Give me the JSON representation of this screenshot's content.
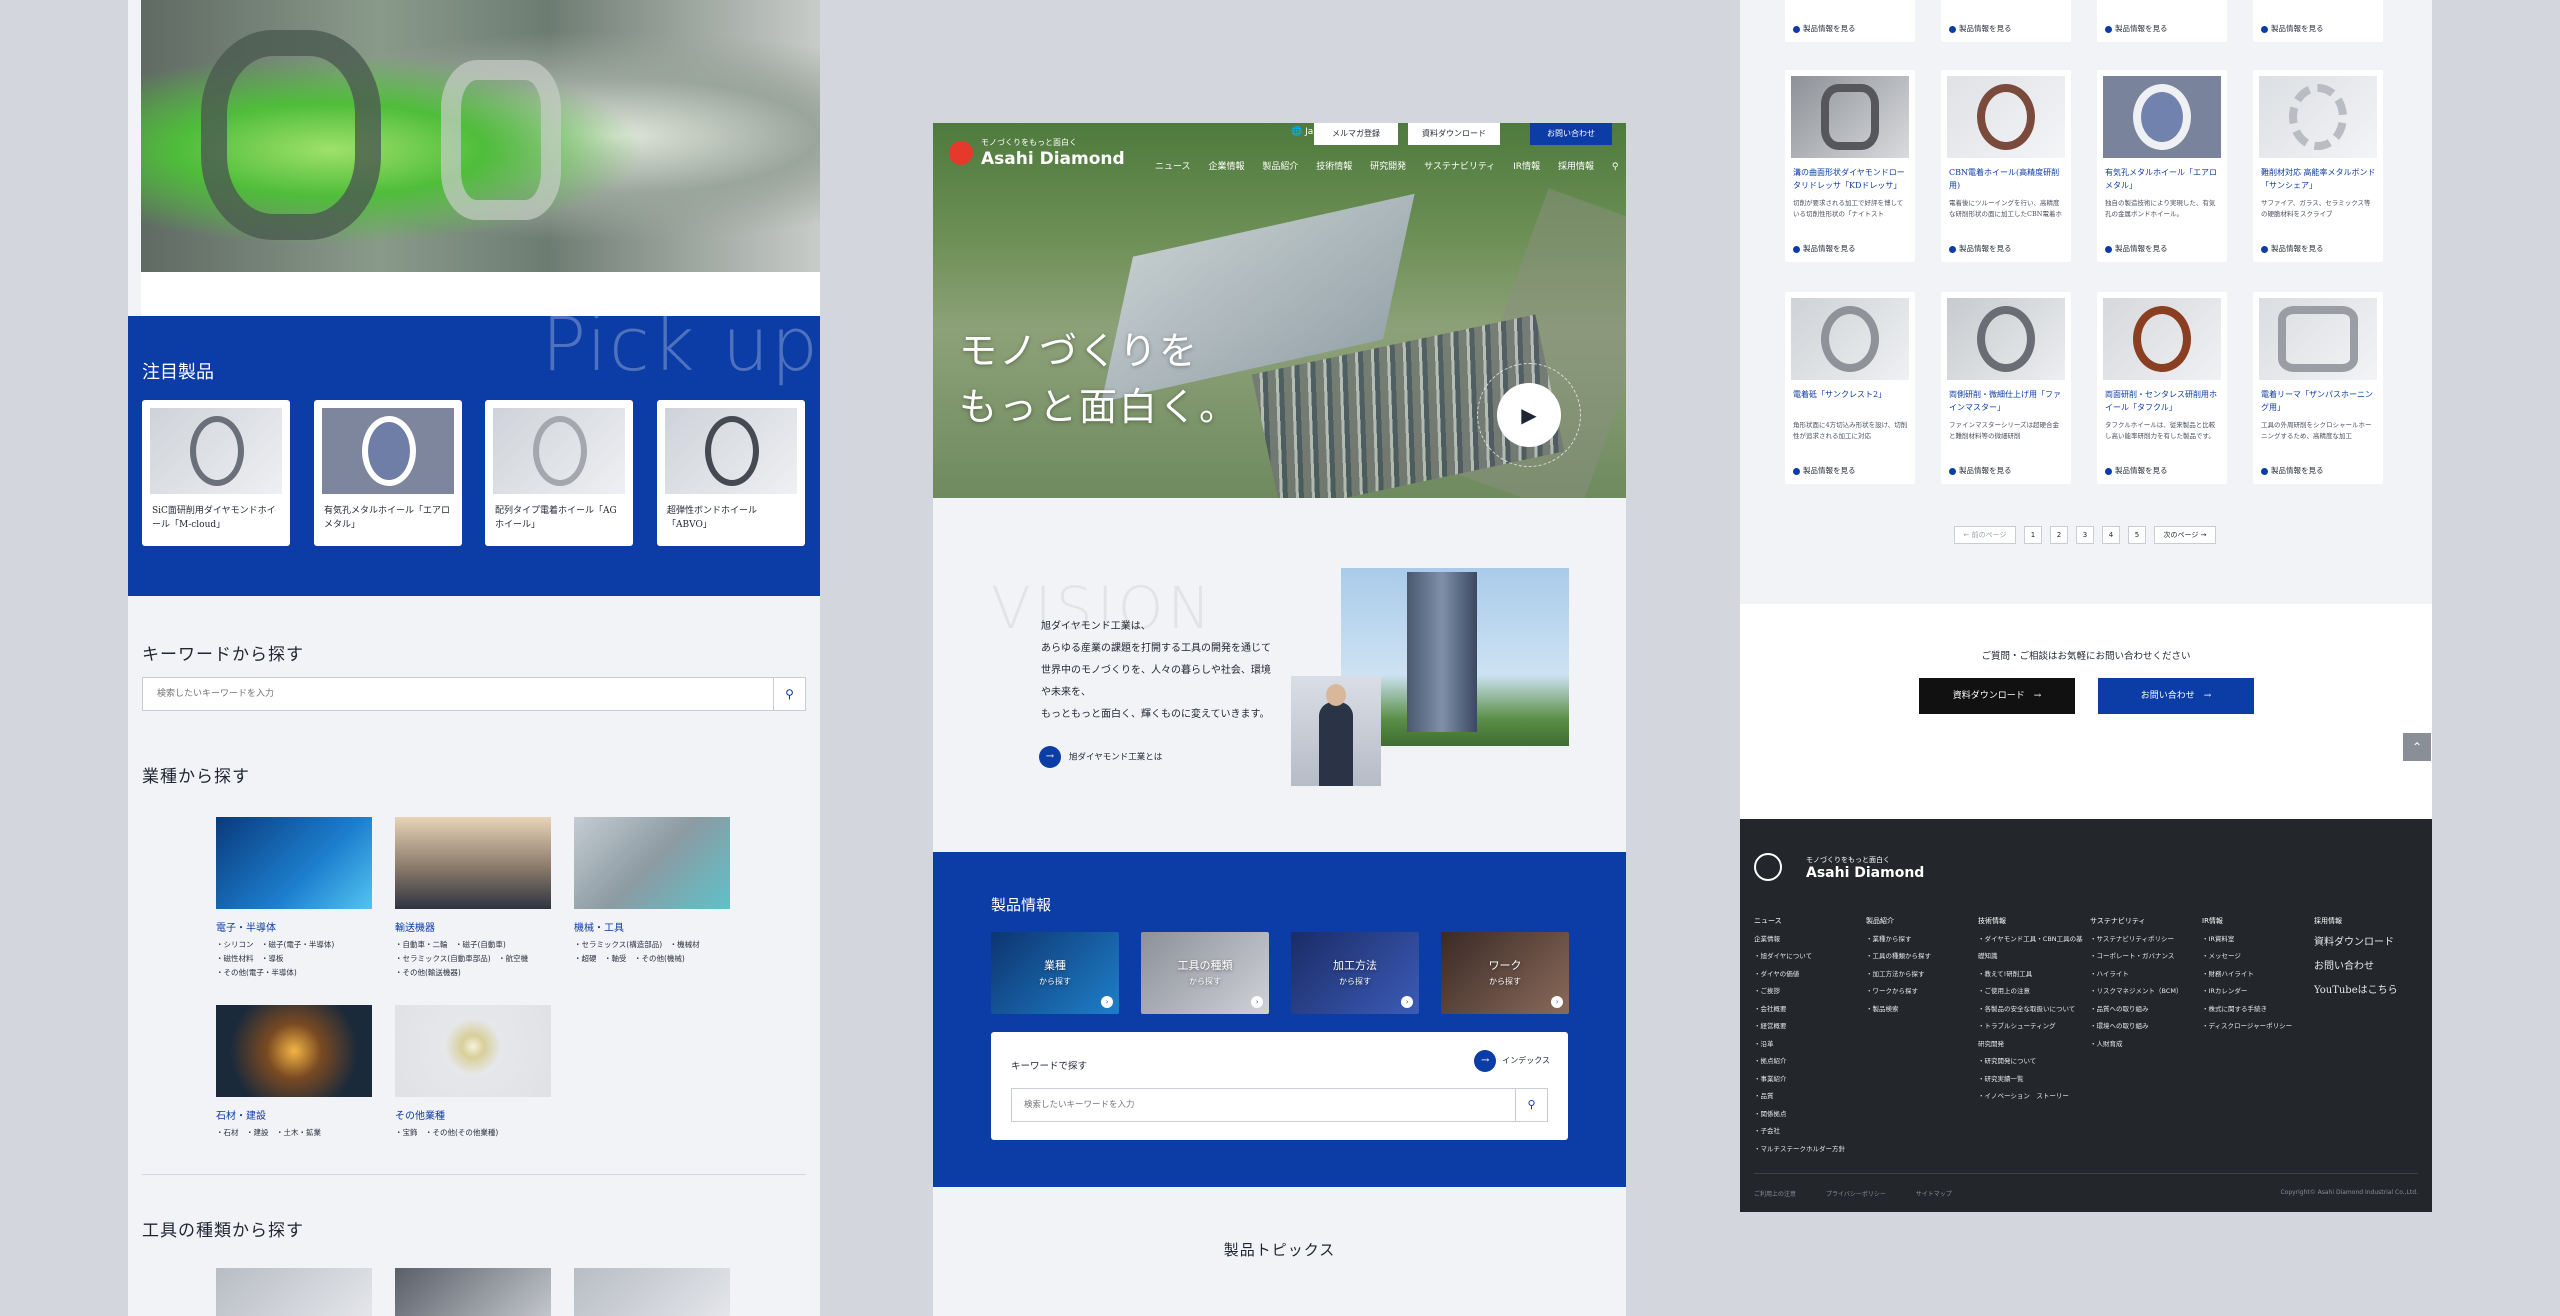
{
  "left": {
    "pickup_bg": "Pick up",
    "pickup_title": "注目製品",
    "pickup_items": [
      "SiC面研削用ダイヤモンドホイール「M-cloud」",
      "有気孔メタルホイール「エアロメタル」",
      "配列タイプ電着ホイール「AGホイール」",
      "超弾性ボンドホイール「ABVO」"
    ],
    "keyword_title": "キーワードから探す",
    "keyword_placeholder": "検索したいキーワードを入力",
    "industry_title": "業種から探す",
    "industries": [
      {
        "name": "電子・半導体",
        "sub": "・シリコン　・磁子(電子・半導体)\n・磁性材料　・導板\n・その他(電子・半導体)"
      },
      {
        "name": "輸送機器",
        "sub": "・自動車・二輪　・磁子(自動車)\n・セラミックス(自動車部品)　・航空機\n・その他(輸送機器)"
      },
      {
        "name": "機械・工具",
        "sub": "・セラミックス(構造部品)　・機械材\n・超硬　・軸受　・その他(機械)"
      },
      {
        "name": "石材・建設",
        "sub": "・石材　・建設　・土木・鉱業"
      },
      {
        "name": "その他業種",
        "sub": "・宝飾　・その他(その他業種)"
      }
    ],
    "tool_title": "工具の種類から探す"
  },
  "center": {
    "logo_tag": "モノづくりをもっと面白く",
    "logo_name": "Asahi Diamond",
    "lang": "Japanese",
    "top_buttons": [
      "メルマガ登録",
      "資料ダウンロード",
      "お問い合わせ"
    ],
    "nav": [
      "ニュース",
      "企業情報",
      "製品紹介",
      "技術情報",
      "研究開発",
      "サステナビリティ",
      "IR情報",
      "採用情報"
    ],
    "hero_line1": "モノづくりを",
    "hero_line2": "もっと面白く。",
    "vision_bg": "VISION",
    "vision_lines": [
      "旭ダイヤモンド工業は、",
      "あらゆる産業の課題を打開する工具の開発を通じて",
      "世界中のモノづくりを、人々の暮らしや社会、環境",
      "や未来を、",
      "もっともっと面白く、輝くものに変えていきます。"
    ],
    "vision_link": "旭ダイヤモンド工業とは",
    "products_title": "製品情報",
    "product_tiles": [
      {
        "title": "業種",
        "sub": "から探す"
      },
      {
        "title": "工具の種類",
        "sub": "から探す"
      },
      {
        "title": "加工方法",
        "sub": "から探す"
      },
      {
        "title": "ワーク",
        "sub": "から探す"
      }
    ],
    "keyword_title": "キーワードで探す",
    "index_link": "インデックス",
    "keyword_placeholder": "検索したいキーワードを入力",
    "topics_title": "製品トピックス"
  },
  "right": {
    "link_label": "製品情報を見る",
    "cards": [
      {
        "title": "溝の曲面形状ダイヤモンドロータリドレッサ「KDドレッサ」",
        "desc": "切削が要求される加工で好評を博している切削性形状の「ナイトスト"
      },
      {
        "title": "CBN電着ホイール(高精度研削用)",
        "desc": "電着後にツルーイングを行い、高精度な研削形状の面に加工したCBN電着ホ"
      },
      {
        "title": "有気孔メタルホイール「エアロメタル」",
        "desc": "独自の製造技術により実現した、有気孔の金属ボンドホイール。"
      },
      {
        "title": "難削材対応 高能率メタルボンド「サンシェア」",
        "desc": "サファイア、ガラス、セラミックス等の硬脆材料をスクライブ"
      },
      {
        "title": "電着砥「サンクレスト2」",
        "desc": "角形状面に4方切込み形状を設け、切削性が追求される加工に対応"
      },
      {
        "title": "両側研削・微細仕上げ用「ファインマスター」",
        "desc": "ファインマスターシリーズは超硬合金と難削材料等の微細研削"
      },
      {
        "title": "両面研削・センタレス研削用ホイール「タフクル」",
        "desc": "タフクルホイールは、従来製品と比較し高い能率研削力を有した製品です。"
      },
      {
        "title": "電着リーマ「ザンパスホーニング用」",
        "desc": "工具の外周研削をシクロシャールホーニングするため、高精度な加工"
      }
    ],
    "pager": {
      "prev": "← 前のページ",
      "pages": [
        "1",
        "2",
        "3",
        "4",
        "5"
      ],
      "next": "次のページ →"
    },
    "contact_text": "ご質問・ご相談はお気軽にお問い合わせください",
    "download_btn": "資料ダウンロード　→",
    "contact_btn": "お問い合わせ　→",
    "footer_tag": "モノづくりをもっと面白く",
    "footer_name": "Asahi Diamond",
    "footer_cols": [
      {
        "head": "ニュース",
        "items": [
          "企業情報",
          "・旭ダイヤについて",
          "・ダイヤの価値",
          "・ご挨拶",
          "・会社概要",
          "・経営概要",
          "・沿革",
          "・拠点紹介",
          "・事業紹介",
          "・品質",
          "・関係拠点",
          "・子会社",
          "・マルチステークホルダー方針"
        ]
      },
      {
        "head": "製品紹介",
        "items": [
          "・業種から探す",
          "・工具の種類から探す",
          "・加工方法から探す",
          "・ワークから探す",
          "・製品検索"
        ]
      },
      {
        "head": "技術情報",
        "items": [
          "・ダイヤモンド工具・CBN工具の基礎知識",
          "・教えて!研削工具",
          "・ご使用上の注意",
          "・各製品の安全な取扱いについて",
          "・トラブルシューティング",
          "研究開発",
          "・研究開発について",
          "・研究実績一覧",
          "・イノベーション　ストーリー"
        ]
      },
      {
        "head": "サステナビリティ",
        "items": [
          "・サステナビリティポリシー",
          "・コーポレート・ガバナンス",
          "・ハイライト",
          "・リスクマネジメント（BCM）",
          "・品質への取り組み",
          "・環境への取り組み",
          "・人財育成"
        ]
      },
      {
        "head": "IR情報",
        "items": [
          "・IR資料室",
          "・メッセージ",
          "・財務ハイライト",
          "・IRカレンダー",
          "・株式に関する手続き",
          "・ディスクロージャーポリシー"
        ]
      },
      {
        "head": "採用情報",
        "items": [
          "資料ダウンロード",
          "お問い合わせ",
          "YouTubeはこちら"
        ]
      }
    ],
    "footer_links": [
      "ご利用上の注意",
      "プライバシーポリシー",
      "サイトマップ"
    ],
    "copyright": "Copyright© Asahi Diamond Industrial Co.,Ltd."
  }
}
